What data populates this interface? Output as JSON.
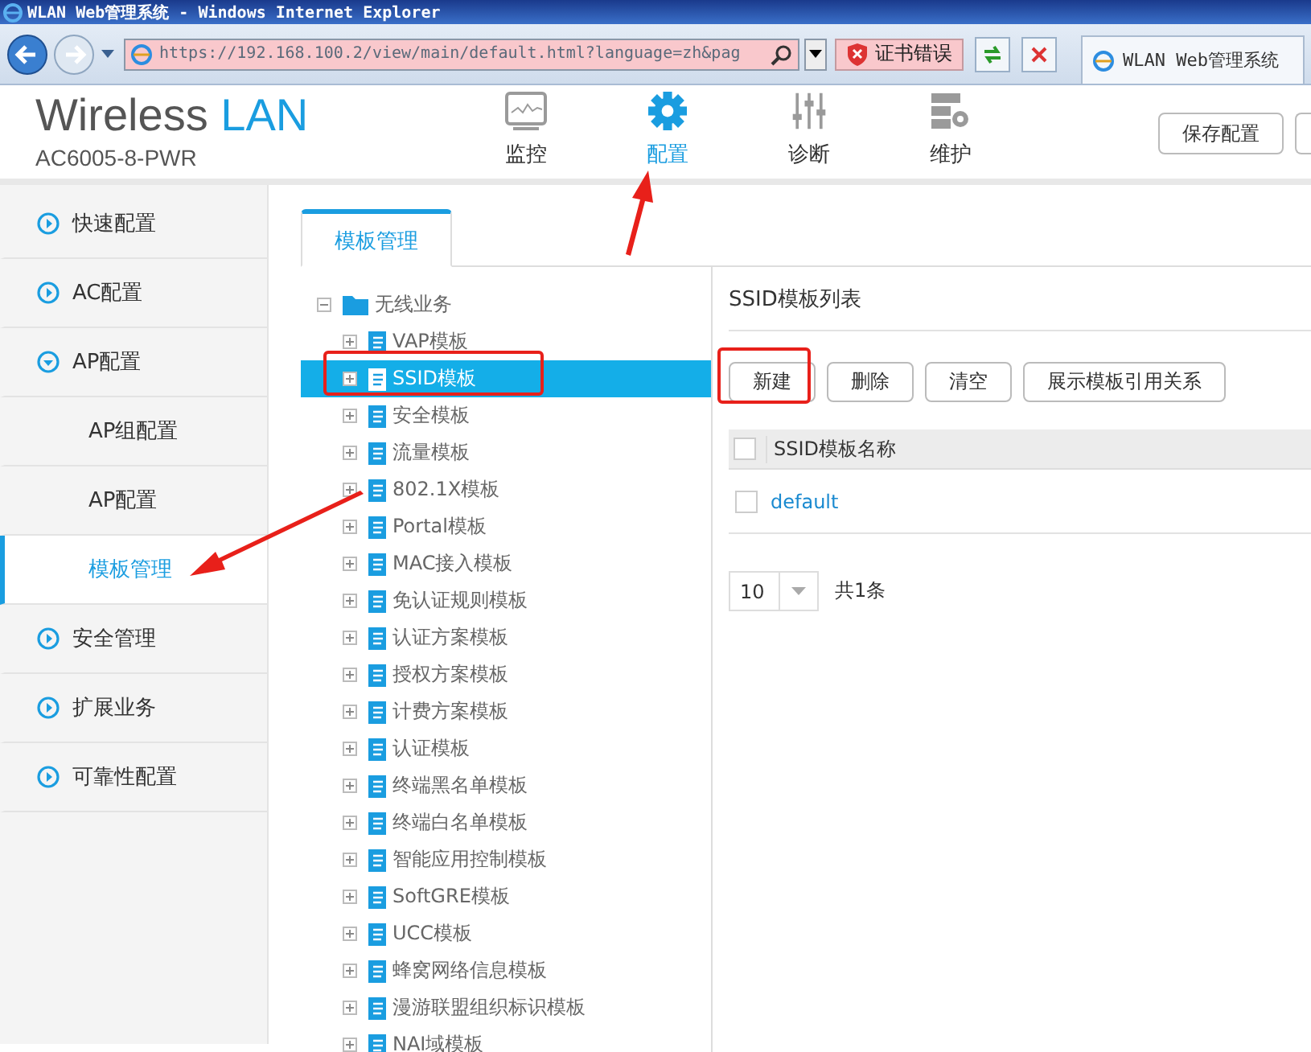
{
  "browser": {
    "title": "WLAN Web管理系统 - Windows Internet Explorer",
    "address": "https://192.168.100.2/view/main/default.html?language=zh&pag",
    "cert_error": "证书错误",
    "tab": "WLAN Web管理系统"
  },
  "header": {
    "logo_main": "Wireless",
    "logo_accent": "LAN",
    "model": "AC6005-8-PWR",
    "nav": [
      {
        "label": "监控",
        "kind": "monitor",
        "selected": false
      },
      {
        "label": "配置",
        "kind": "gear",
        "selected": true
      },
      {
        "label": "诊断",
        "kind": "sliders",
        "selected": false
      },
      {
        "label": "维护",
        "kind": "server",
        "selected": false
      }
    ],
    "buttons": [
      "保存配置"
    ]
  },
  "sidebar": [
    {
      "label": "快速配置",
      "kind": "group",
      "expanded": false,
      "selected": false
    },
    {
      "label": "AC配置",
      "kind": "group",
      "expanded": false,
      "selected": false
    },
    {
      "label": "AP配置",
      "kind": "group",
      "expanded": true,
      "selected": false
    },
    {
      "label": "AP组配置",
      "kind": "sub",
      "selected": false
    },
    {
      "label": "AP配置",
      "kind": "sub",
      "selected": false
    },
    {
      "label": "模板管理",
      "kind": "sub",
      "selected": true
    },
    {
      "label": "安全管理",
      "kind": "group",
      "expanded": false,
      "selected": false
    },
    {
      "label": "扩展业务",
      "kind": "group",
      "expanded": false,
      "selected": false
    },
    {
      "label": "可靠性配置",
      "kind": "group",
      "expanded": false,
      "selected": false
    }
  ],
  "tabs": [
    {
      "label": "模板管理",
      "selected": true
    }
  ],
  "tree": [
    {
      "label": "无线业务",
      "expanded": true,
      "selected": false,
      "children": [
        {
          "label": "VAP模板",
          "expanded": false,
          "selected": false
        },
        {
          "label": "SSID模板",
          "expanded": false,
          "selected": true
        },
        {
          "label": "安全模板",
          "expanded": false,
          "selected": false
        },
        {
          "label": "流量模板",
          "expanded": false,
          "selected": false
        },
        {
          "label": "802.1X模板",
          "expanded": false,
          "selected": false
        },
        {
          "label": "Portal模板",
          "expanded": false,
          "selected": false
        },
        {
          "label": "MAC接入模板",
          "expanded": false,
          "selected": false
        },
        {
          "label": "免认证规则模板",
          "expanded": false,
          "selected": false
        },
        {
          "label": "认证方案模板",
          "expanded": false,
          "selected": false
        },
        {
          "label": "授权方案模板",
          "expanded": false,
          "selected": false
        },
        {
          "label": "计费方案模板",
          "expanded": false,
          "selected": false
        },
        {
          "label": "认证模板",
          "expanded": false,
          "selected": false
        },
        {
          "label": "终端黑名单模板",
          "expanded": false,
          "selected": false
        },
        {
          "label": "终端白名单模板",
          "expanded": false,
          "selected": false
        },
        {
          "label": "智能应用控制模板",
          "expanded": false,
          "selected": false
        },
        {
          "label": "SoftGRE模板",
          "expanded": false,
          "selected": false
        },
        {
          "label": "UCC模板",
          "expanded": false,
          "selected": false
        },
        {
          "label": "蜂窝网络信息模板",
          "expanded": false,
          "selected": false
        },
        {
          "label": "漫游联盟组织标识模板",
          "expanded": false,
          "selected": false
        },
        {
          "label": "NAI域模板",
          "expanded": false,
          "selected": false
        }
      ]
    }
  ],
  "panel": {
    "title": "SSID模板列表",
    "buttons": [
      "新建",
      "删除",
      "清空",
      "展示模板引用关系"
    ],
    "table": {
      "columns": [
        {
          "label": "SSID模板名称",
          "checked": false
        }
      ],
      "rows": [
        {
          "name": "default",
          "checked": false
        }
      ]
    },
    "pager": {
      "page_size": "10",
      "total": "共1条"
    }
  }
}
